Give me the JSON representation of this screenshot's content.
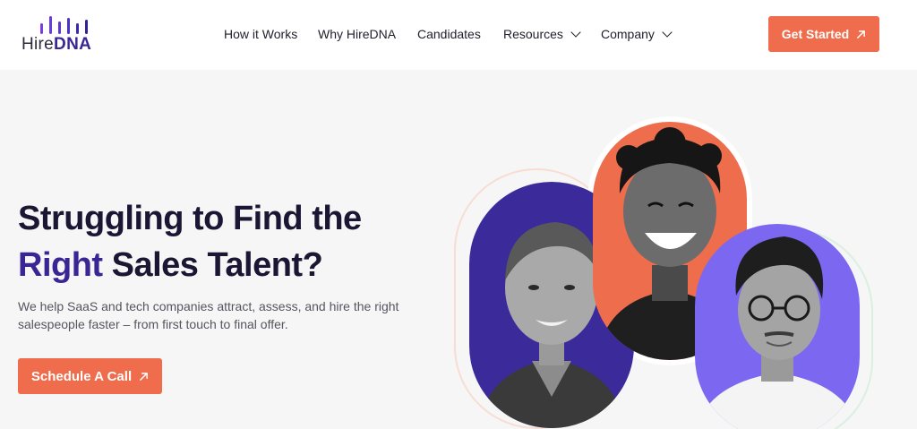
{
  "brand": {
    "logo_prefix": "Hire",
    "logo_suffix": "DNA"
  },
  "nav": {
    "items": [
      {
        "label": "How it Works",
        "has_dropdown": false
      },
      {
        "label": "Why HireDNA",
        "has_dropdown": false
      },
      {
        "label": "Candidates",
        "has_dropdown": false
      },
      {
        "label": "Resources",
        "has_dropdown": true
      },
      {
        "label": "Company",
        "has_dropdown": true
      }
    ],
    "cta_label": "Get Started"
  },
  "hero": {
    "headline_line1": "Struggling to Find the",
    "headline_accent": "Right",
    "headline_line2_rest": " Sales Talent?",
    "subtext": "We help SaaS and tech companies attract, assess, and hire the right salespeople faster – from first touch to final offer.",
    "cta_label": "Schedule A Call"
  },
  "portraits": [
    {
      "name": "woman-portrait",
      "bg_color": "#3b2a9a"
    },
    {
      "name": "laughing-man-portrait",
      "bg_color": "#ee6d4c"
    },
    {
      "name": "man-with-glasses-portrait",
      "bg_color": "#7c67f0"
    }
  ],
  "colors": {
    "accent": "#ef6c4c",
    "brand_purple": "#3a2594",
    "heading": "#1a1633"
  },
  "icons": [
    "logo-bars-icon",
    "chevron-down-icon",
    "arrow-up-right-icon"
  ]
}
